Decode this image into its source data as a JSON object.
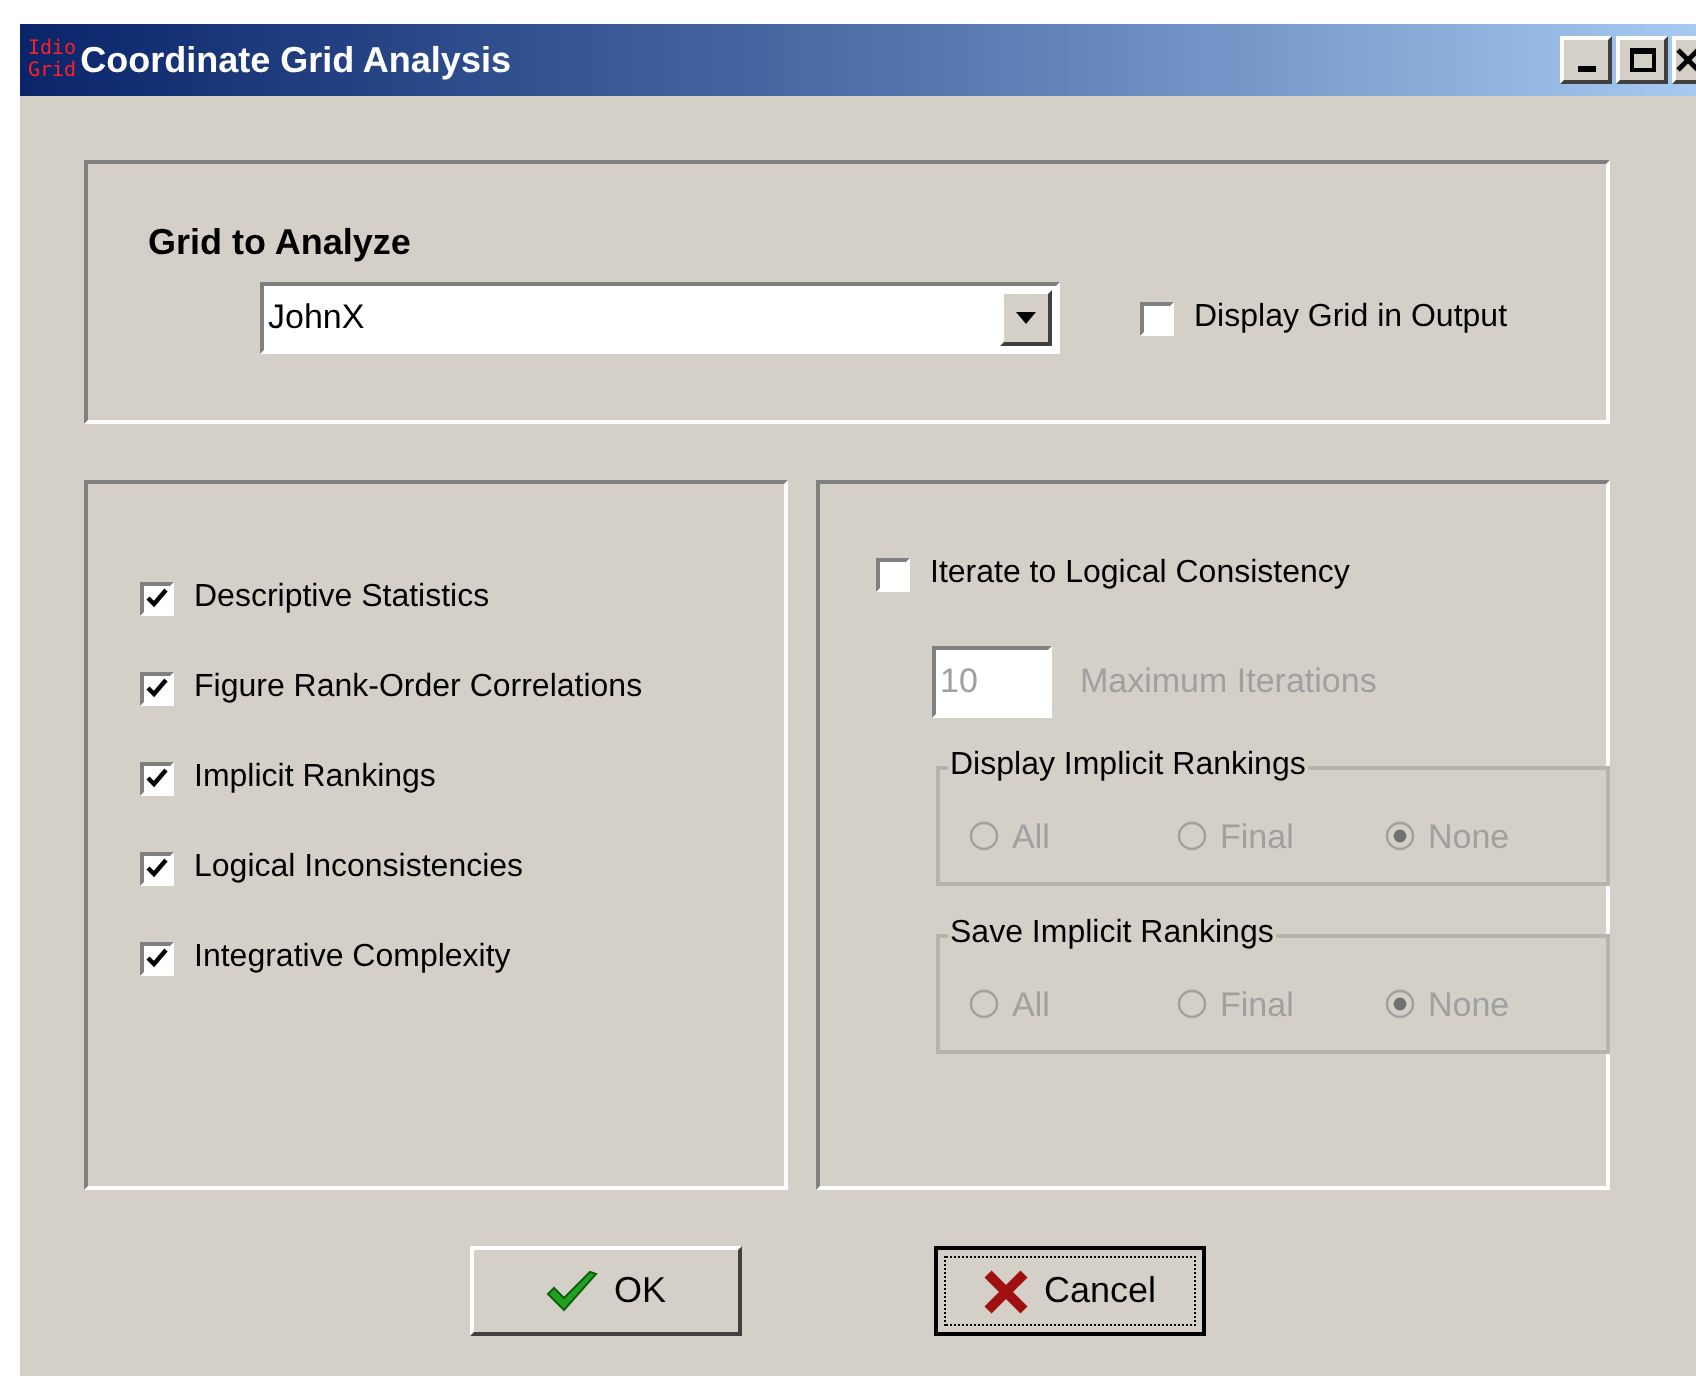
{
  "window": {
    "logo": [
      "Idio",
      "Grid"
    ],
    "title": "Coordinate Grid Analysis"
  },
  "grid_group": {
    "label": "Grid to Analyze",
    "value": "JohnX",
    "display_in_output": {
      "label": "Display Grid in Output",
      "checked": false
    }
  },
  "options": [
    {
      "label": "Descriptive Statistics",
      "checked": true
    },
    {
      "label": "Figure Rank-Order Correlations",
      "checked": true
    },
    {
      "label": "Implicit Rankings",
      "checked": true
    },
    {
      "label": "Logical Inconsistencies",
      "checked": true
    },
    {
      "label": "Integrative Complexity",
      "checked": true
    }
  ],
  "iterate": {
    "label": "Iterate to Logical Consistency",
    "checked": false
  },
  "max_iterations": {
    "value": "10",
    "label": "Maximum Iterations",
    "disabled": true
  },
  "radio_groups": [
    {
      "label": "Display Implicit Rankings",
      "disabled": true,
      "options": [
        {
          "label": "All",
          "selected": false
        },
        {
          "label": "Final",
          "selected": false
        },
        {
          "label": "None",
          "selected": true
        }
      ]
    },
    {
      "label": "Save Implicit Rankings",
      "disabled": true,
      "options": [
        {
          "label": "All",
          "selected": false
        },
        {
          "label": "Final",
          "selected": false
        },
        {
          "label": "None",
          "selected": true
        }
      ]
    }
  ],
  "buttons": [
    {
      "label": "OK",
      "kind": "ok",
      "focused": false
    },
    {
      "label": "Cancel",
      "kind": "cancel",
      "focused": true
    }
  ]
}
